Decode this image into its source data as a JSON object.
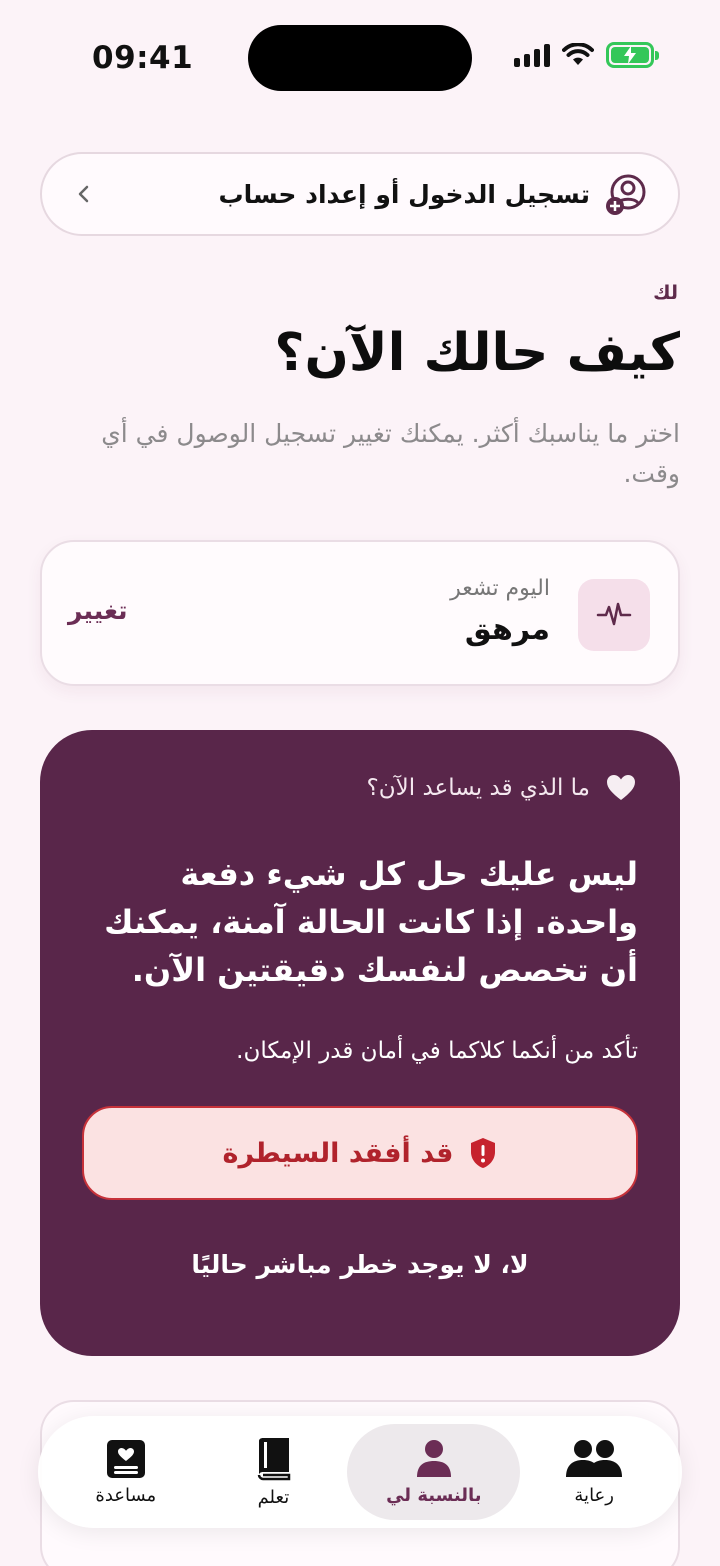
{
  "status_bar": {
    "time": "09:41"
  },
  "login": {
    "label": "تسجيل الدخول أو إعداد حساب",
    "icon": "user-add-icon"
  },
  "header": {
    "eyebrow": "لك",
    "title": "كيف حالك الآن؟",
    "subtitle": "اختر ما يناسبك أكثر. يمكنك تغيير تسجيل الوصول في أي وقت."
  },
  "mood": {
    "caption": "اليوم تشعر",
    "value": "مرهق",
    "change_label": "تغيير",
    "icon": "pulse-icon"
  },
  "help": {
    "heading": "ما الذي قد يساعد الآن؟",
    "body": "ليس عليك حل كل شيء دفعة واحدة. إذا كانت الحالة آمنة، يمكنك أن تخصص لنفسك دقيقتين الآن.",
    "note": "تأكد من أنكما كلاكما في أمان قدر الإمكان.",
    "danger_button": "قد أفقد السيطرة",
    "safe_link": "لا، لا يوجد خطر مباشر حاليًا",
    "colors": {
      "card": "#59264A",
      "danger": "#B0232C",
      "danger_bg": "#FBE2E2"
    }
  },
  "tabs": [
    {
      "label": "رعاية",
      "icon": "people-icon",
      "active": false
    },
    {
      "label": "بالنسبة لي",
      "icon": "person-icon",
      "active": true
    },
    {
      "label": "تعلم",
      "icon": "book-icon",
      "active": false
    },
    {
      "label": "مساعدة",
      "icon": "help-card-icon",
      "active": false
    }
  ]
}
